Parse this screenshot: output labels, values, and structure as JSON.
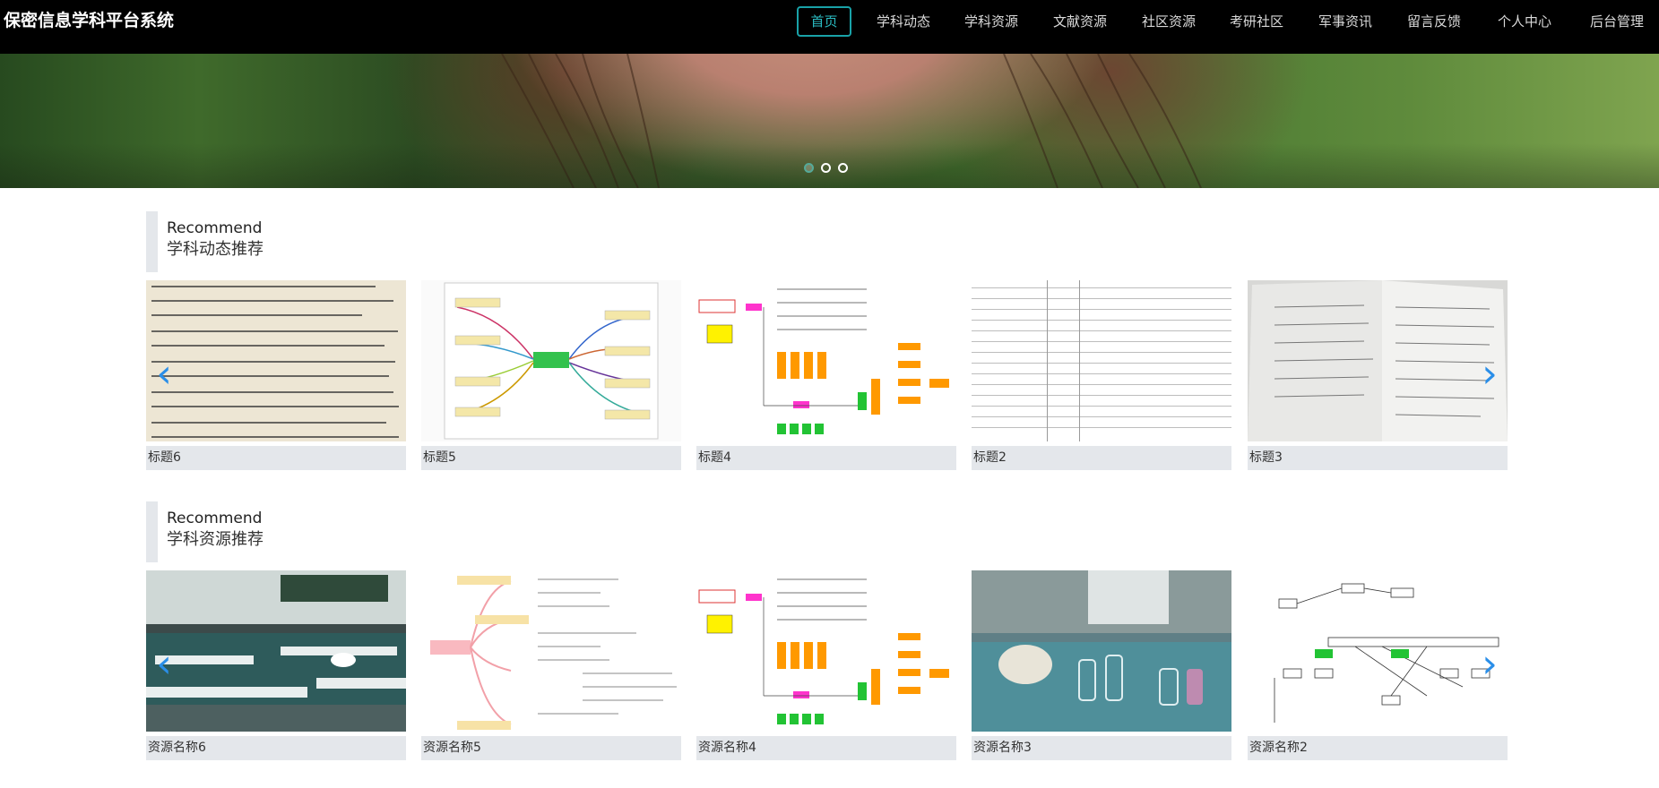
{
  "brand": "保密信息学科平台系统",
  "nav": [
    {
      "label": "首页",
      "active": true
    },
    {
      "label": "学科动态",
      "active": false
    },
    {
      "label": "学科资源",
      "active": false
    },
    {
      "label": "文献资源",
      "active": false
    },
    {
      "label": "社区资源",
      "active": false
    },
    {
      "label": "考研社区",
      "active": false
    },
    {
      "label": "军事资讯",
      "active": false
    },
    {
      "label": "留言反馈",
      "active": false
    },
    {
      "label": "个人中心",
      "active": false
    },
    {
      "label": "后台管理",
      "active": false
    }
  ],
  "carousel": {
    "slides": 3,
    "active_index": 0
  },
  "sections": [
    {
      "en_title": "Recommend",
      "cn_title": "学科动态推荐",
      "items": [
        {
          "caption": "标题6",
          "thumb": "text-photo"
        },
        {
          "caption": "标题5",
          "thumb": "mind-map"
        },
        {
          "caption": "标题4",
          "thumb": "flow-chart"
        },
        {
          "caption": "标题2",
          "thumb": "table-document"
        },
        {
          "caption": "标题3",
          "thumb": "notebook-photo"
        }
      ]
    },
    {
      "en_title": "Recommend",
      "cn_title": "学科资源推荐",
      "items": [
        {
          "caption": "资源名称6",
          "thumb": "lab-room-photo"
        },
        {
          "caption": "资源名称5",
          "thumb": "mind-map-pink"
        },
        {
          "caption": "资源名称4",
          "thumb": "flow-chart"
        },
        {
          "caption": "资源名称3",
          "thumb": "lab-experiment-photo"
        },
        {
          "caption": "资源名称2",
          "thumb": "flow-chart-green"
        }
      ]
    }
  ],
  "icons": {
    "prev": "chevron-left-icon",
    "next": "chevron-right-icon"
  },
  "colors": {
    "nav_active": "#19a2a8",
    "arrow": "#2a8ee8",
    "caption_bg": "#e4e7eb"
  }
}
